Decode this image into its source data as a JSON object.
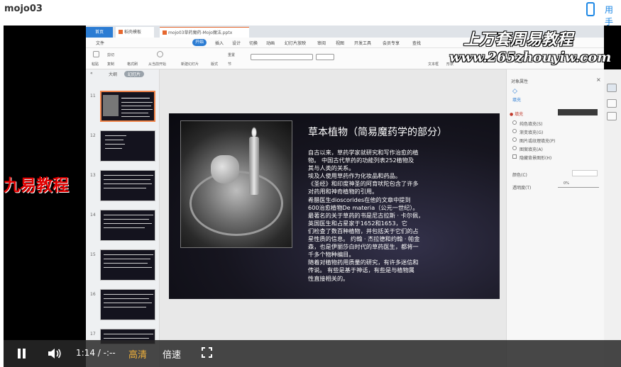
{
  "page": {
    "title": "mojo03",
    "user_label": "用手"
  },
  "tabs": {
    "home": "首页",
    "template": "稻壳模板",
    "file": "mojo03草药魔药-Mojo魔法.pptx"
  },
  "menu": [
    "文件",
    "开始",
    "插入",
    "设计",
    "切换",
    "动画",
    "幻灯片放映",
    "审阅",
    "视图",
    "开发工具",
    "会员专享",
    "查找"
  ],
  "toolbar": {
    "paste": "粘贴",
    "cut": "剪切",
    "copy": "复制",
    "format_painter": "格式刷",
    "from_current": "从当前开始",
    "new_slide": "新建幻灯片",
    "layout": "版式",
    "reset": "重置",
    "section": "节",
    "textbox": "文本框",
    "shape": "形状"
  },
  "watermark": {
    "line1": "上万套周易教程",
    "line2": "www.265zhouyiw.com"
  },
  "left_panel": {
    "tab_outline": "大纲",
    "tab_slides": "幻灯片",
    "slide_numbers": [
      "11",
      "12",
      "13",
      "14",
      "15",
      "16",
      "17"
    ]
  },
  "slide": {
    "title": "草本植物（简易魔药学的部分）",
    "body": [
      "自古以来，草药学家就研究和写作治愈的植",
      "物。  中国古代草药的功能列表252植物及",
      "其与人类的关系。",
      "埃及人使用草药作为化妆品和药品。",
      "《圣经》和印度神圣的阿育吠陀包含了许多",
      "对药用和神奇植物的引用。",
      "  希腊医生dioscorides在他的文章中提到",
      "600治愈植物De materia（公元一世纪）。",
      "最著名的关于草药的书是尼古拉斯 · 卡尔佩，",
      "英国医生和占星家于1652和1653，它",
      "们检查了数百种植物，并包括关于它们的占",
      "星性质的信息。  约翰 · 杰拉德和约翰 · 帕金",
      "森，也是伊丽莎白时代的草药医生，都将一",
      "千多个物种编目。",
      "随着对植物药用质量的研究，有许多迷信和",
      "传说。  有些是基于神话，有些是与植物属",
      "性直接相关的。"
    ]
  },
  "right_panel": {
    "title": "对象属性",
    "fill_tab": "填充",
    "fill_label": "● 填充",
    "options": [
      "纯色填充(S)",
      "渐变填充(G)",
      "图片或纹理填充(P)",
      "图案填充(A)",
      "隐藏背景图形(H)"
    ],
    "color_label": "颜色(C)",
    "transparency_label": "透明度(T)",
    "transparency_value": "0%"
  },
  "side_ad": "九易教程",
  "player": {
    "time": "1:14 / -:--",
    "quality": "高清",
    "speed": "倍速"
  }
}
